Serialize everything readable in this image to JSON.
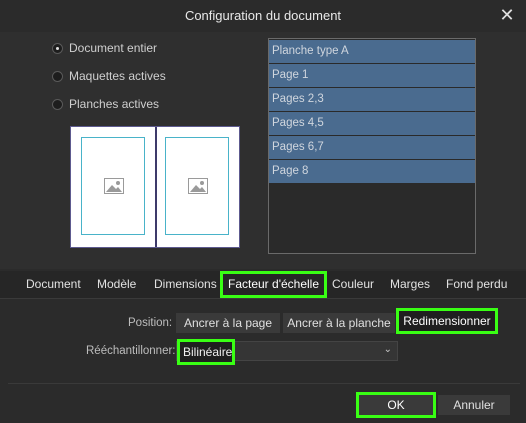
{
  "dialog": {
    "title": "Configuration du document",
    "close_symbol": "✕"
  },
  "scope": {
    "options": [
      {
        "label": "Document entier",
        "checked": true
      },
      {
        "label": "Maquettes actives",
        "checked": false
      },
      {
        "label": "Planches actives",
        "checked": false
      }
    ]
  },
  "pages_list": {
    "items": [
      "Planche type A",
      "Page 1",
      "Pages 2,3",
      "Pages 4,5",
      "Pages 6,7",
      "Page 8"
    ]
  },
  "tabs": [
    {
      "label": "Document",
      "active": false
    },
    {
      "label": "Modèle",
      "active": false
    },
    {
      "label": "Dimensions",
      "active": false
    },
    {
      "label": "Facteur d'échelle",
      "active": true
    },
    {
      "label": "Couleur",
      "active": false
    },
    {
      "label": "Marges",
      "active": false
    },
    {
      "label": "Fond perdu",
      "active": false
    }
  ],
  "scale": {
    "position_label": "Position:",
    "position_buttons": [
      "Ancrer à la page",
      "Ancrer à la planche",
      "Redimensionner"
    ],
    "resample_label": "Rééchantillonner:",
    "resample_value": "Bilinéaire"
  },
  "footer": {
    "ok_label": "OK",
    "cancel_label": "Annuler"
  },
  "colors": {
    "highlight": "#39ff14",
    "list_selected": "#4a6b8f",
    "preview_frame": "#49b3c9"
  }
}
